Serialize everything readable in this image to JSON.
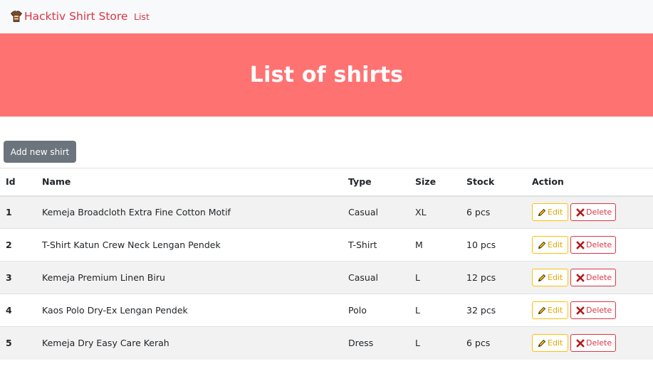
{
  "navbar": {
    "brand": "Hacktiv Shirt Store",
    "brand_icon": "shirt-icon",
    "links": [
      "List"
    ]
  },
  "hero": {
    "title": "List of shirts"
  },
  "toolbar": {
    "add_button": "Add new shirt"
  },
  "table": {
    "headers": {
      "id": "Id",
      "name": "Name",
      "type": "Type",
      "size": "Size",
      "stock": "Stock",
      "action": "Action"
    },
    "rows": [
      {
        "id": "1",
        "name": "Kemeja Broadcloth Extra Fine Cotton Motif",
        "type": "Casual",
        "size": "XL",
        "stock": "6 pcs"
      },
      {
        "id": "2",
        "name": "T-Shirt Katun Crew Neck Lengan Pendek",
        "type": "T-Shirt",
        "size": "M",
        "stock": "10 pcs"
      },
      {
        "id": "3",
        "name": "Kemeja Premium Linen Biru",
        "type": "Casual",
        "size": "L",
        "stock": "12 pcs"
      },
      {
        "id": "4",
        "name": "Kaos Polo Dry-Ex Lengan Pendek",
        "type": "Polo",
        "size": "L",
        "stock": "32 pcs"
      },
      {
        "id": "5",
        "name": "Kemeja Dry Easy Care Kerah",
        "type": "Dress",
        "size": "L",
        "stock": "6 pcs"
      }
    ],
    "actions": {
      "edit": "Edit",
      "delete": "Delete"
    }
  },
  "colors": {
    "brand": "#dc3545",
    "hero_bg": "#ff7272",
    "edit": "#ffc107",
    "delete": "#dc3545",
    "add_button": "#6c757d"
  }
}
